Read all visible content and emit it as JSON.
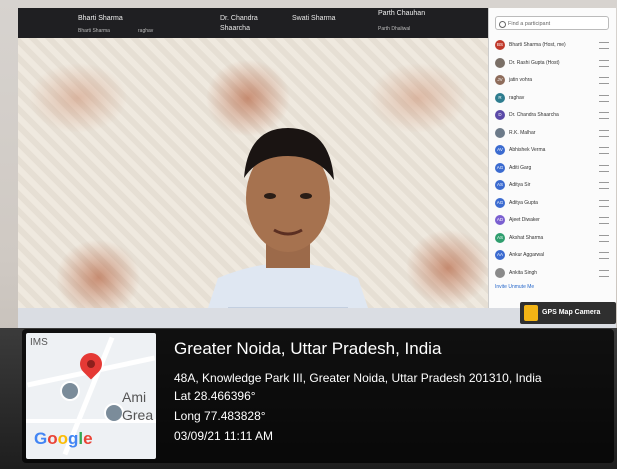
{
  "meeting": {
    "top_tiles": [
      {
        "name": "Bharti Sharma"
      },
      {
        "name": "Dr. Chandra Shaarcha"
      },
      {
        "name": "Swati Sharma"
      },
      {
        "name": "Parth Chauhan"
      }
    ],
    "top_sub": [
      "Bharti Sharma",
      "raghav",
      "Parth Dhaliwal"
    ]
  },
  "participants": {
    "search_placeholder": "Find a participant",
    "items": [
      {
        "initials": "BS",
        "name": "Bharti Sharma (Host, me)",
        "color": "#c0392b"
      },
      {
        "initials": "",
        "name": "Dr. Rashi Gupta (Host)",
        "color": "#7a6f66"
      },
      {
        "initials": "JV",
        "name": "jatin vohra",
        "color": "#8e6c5b"
      },
      {
        "initials": "R",
        "name": "raghav",
        "color": "#2e7d8f"
      },
      {
        "initials": "D",
        "name": "Dr. Chandra Shaarcha",
        "color": "#5b4aa8"
      },
      {
        "initials": "",
        "name": "R.K. Malhar",
        "color": "#6c7a89"
      },
      {
        "initials": "AV",
        "name": "Abhishek Verma",
        "color": "#3b6bd0"
      },
      {
        "initials": "AG",
        "name": "Aditi Garg",
        "color": "#3b6bd0"
      },
      {
        "initials": "AS",
        "name": "Aditya Sir",
        "color": "#3b6bd0"
      },
      {
        "initials": "AG",
        "name": "Aditya Gupta",
        "color": "#3b6bd0"
      },
      {
        "initials": "AD",
        "name": "Ajeet Diwaker",
        "color": "#7a5fd0"
      },
      {
        "initials": "AS",
        "name": "Akshat Sharma",
        "color": "#2f9e6e"
      },
      {
        "initials": "AA",
        "name": "Ankur Aggarwal",
        "color": "#3b6bd0"
      },
      {
        "initials": "",
        "name": "Ankita Singh",
        "color": "#8a8a8a"
      }
    ],
    "footer": "Invite    Unmute Me"
  },
  "gps_badge": "GPS Map Camera",
  "location": {
    "place": "Greater Noida, Uttar Pradesh, India",
    "address": "48A, Knowledge Park III, Greater Noida, Uttar Pradesh 201310, India",
    "lat": "Lat 28.466396°",
    "long": "Long 77.483828°",
    "datetime": "03/09/21 11:11 AM"
  },
  "map": {
    "label_ims": "IMS",
    "label_ami": "Ami",
    "label_gre": "Grea",
    "brand": "Google",
    "pin_color": "#e53935"
  }
}
